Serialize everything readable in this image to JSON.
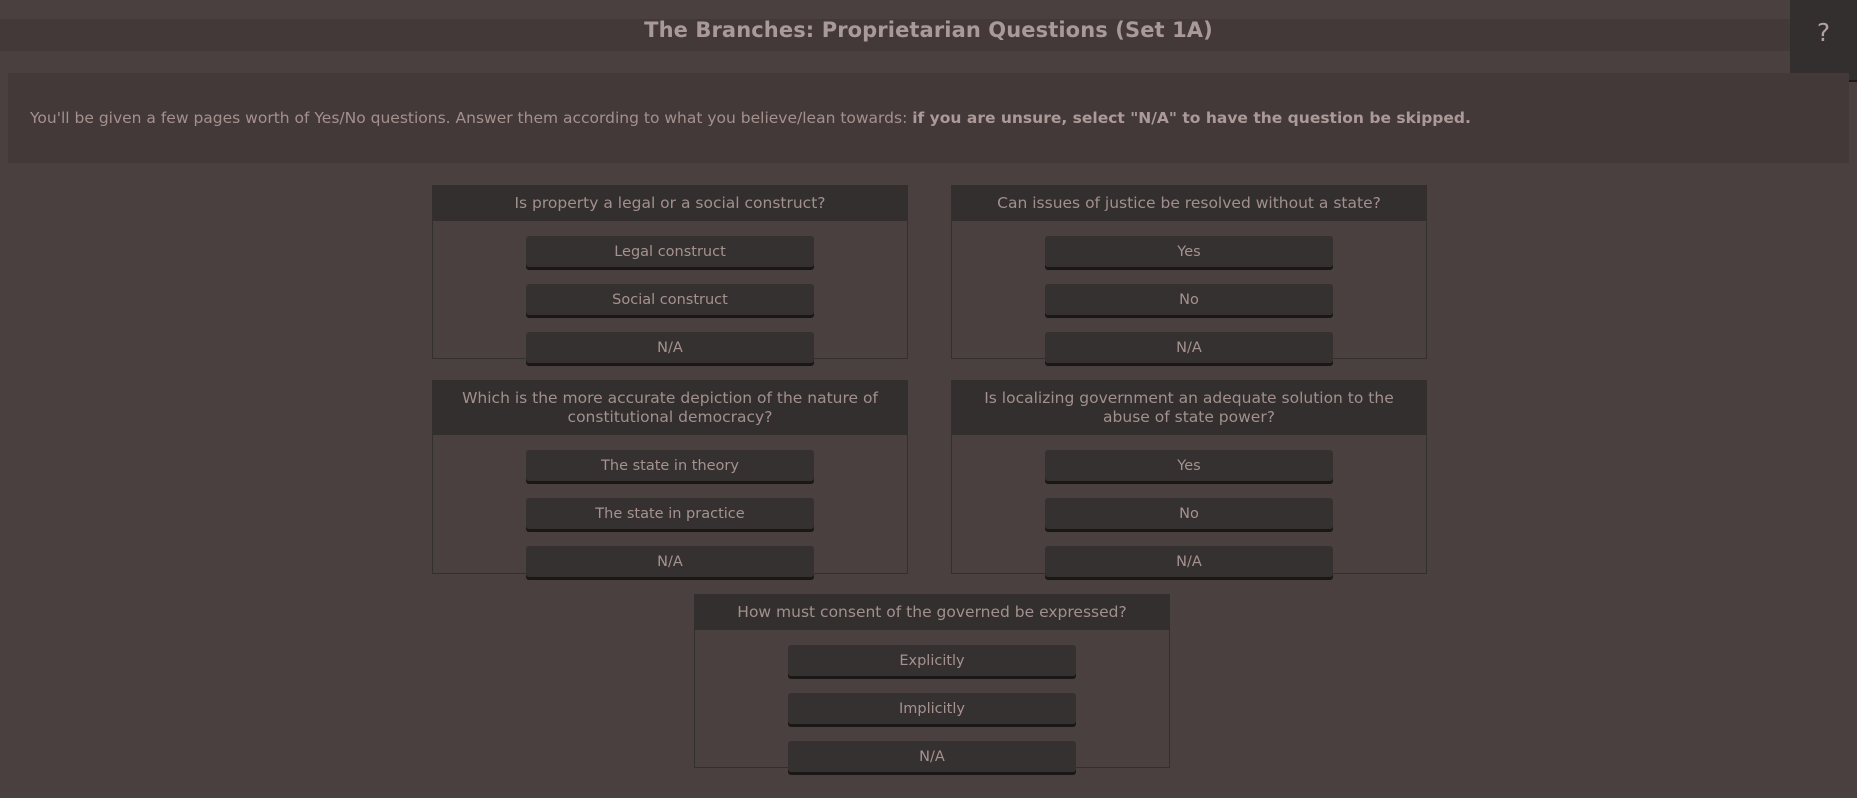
{
  "header": {
    "title": "The Branches: Proprietarian Questions (Set 1A)",
    "help_icon": "question-mark-icon",
    "help_label": "?"
  },
  "instructions": {
    "lead": "You'll be given a few pages worth of Yes/No questions. Answer them according to what you believe/lean towards: ",
    "emphasis": "if you are unsure, select \"N/A\" to have the question be skipped."
  },
  "colors": {
    "page_background": "#4b4040",
    "panel_background": "#433939",
    "card_header": "#332f2e",
    "button_face": "#353130",
    "button_shadow": "#1a1717",
    "text": "#a6928f",
    "title_text": "#a9999a"
  },
  "questions": [
    {
      "id": "q-property-construct",
      "prompt": "Is property a legal or a social construct?",
      "options": [
        "Legal construct",
        "Social construct",
        "N/A"
      ]
    },
    {
      "id": "q-justice-without-state",
      "prompt": "Can issues of justice be resolved without a state?",
      "options": [
        "Yes",
        "No",
        "N/A"
      ]
    },
    {
      "id": "q-constitutional-democracy",
      "prompt": "Which is the more accurate depiction of the nature of constitutional democracy?",
      "options": [
        "The state in theory",
        "The state in practice",
        "N/A"
      ]
    },
    {
      "id": "q-localizing-government",
      "prompt": "Is localizing government an adequate solution to the abuse of state power?",
      "options": [
        "Yes",
        "No",
        "N/A"
      ]
    },
    {
      "id": "q-consent-governed",
      "prompt": "How must consent of the governed be expressed?",
      "options": [
        "Explicitly",
        "Implicitly",
        "N/A"
      ]
    }
  ]
}
